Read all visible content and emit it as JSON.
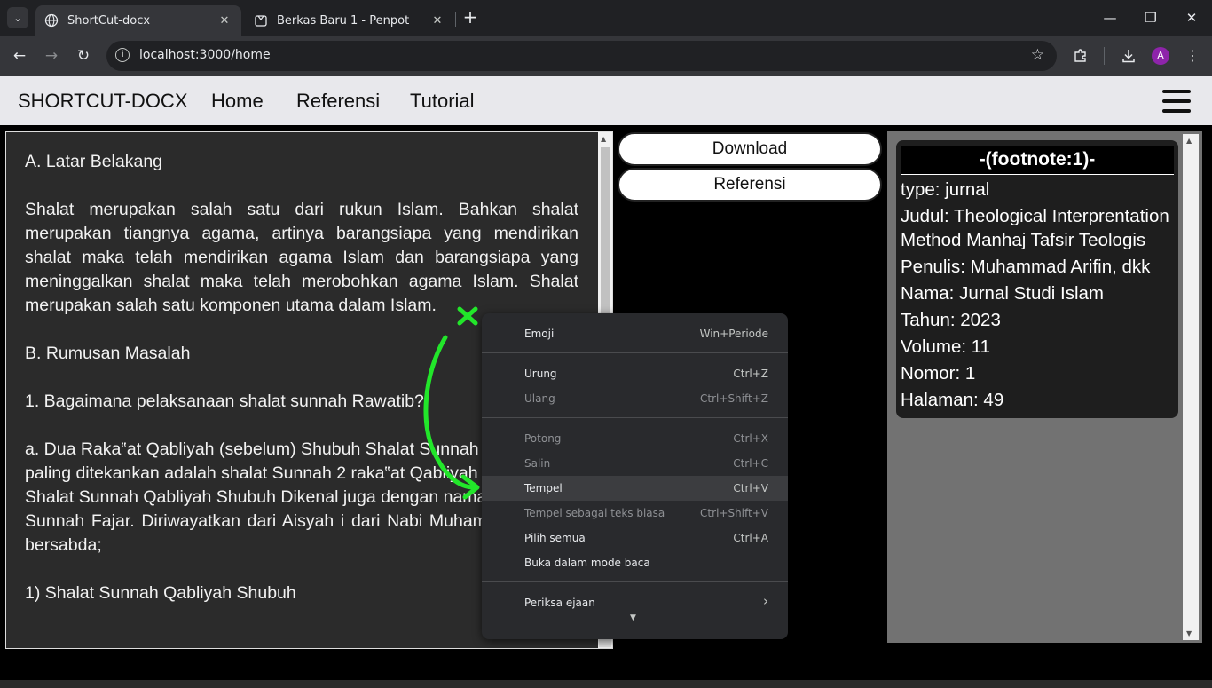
{
  "browser": {
    "tabs": [
      {
        "title": "ShortCut-docx",
        "active": true
      },
      {
        "title": "Berkas Baru 1 - Penpot",
        "active": false
      }
    ],
    "url": "localhost:3000/home",
    "profile_initial": "A"
  },
  "app": {
    "brand": "SHORTCUT-DOCX",
    "nav": [
      "Home",
      "Referensi",
      "Tutorial"
    ],
    "buttons": {
      "download": "Download",
      "referensi": "Referensi"
    }
  },
  "editor": {
    "text": "A. Latar Belakang\n\nShalat merupakan salah satu dari rukun Islam. Bahkan shalat merupakan tiangnya agama, artinya barangsiapa yang mendirikan shalat maka telah mendirikan agama Islam dan barangsiapa yang meninggalkan shalat maka telah merobohkan agama Islam. Shalat merupakan salah satu komponen utama dalam Islam.\n\nB. Rumusan Masalah\n\n1. Bagaimana pelaksanaan shalat sunnah Rawatib?\n\na. Dua Raka‟at Qabliyah (sebelum) Shubuh Shalat Sunnah yang\npaling ditekankan adalah shalat Sunnah 2 raka‟at Qabliyah Shubuh.\nShalat Sunnah Qabliyah Shubuh Dikenal juga dengan nama Shalat\nSunnah Fajar. Diriwayatkan dari Aisyah i dari Nabi Muhammad, beliau bersabda;\n\n1) Shalat Sunnah Qabliyah Shubuh"
  },
  "reference": {
    "title": "-(footnote:1)-",
    "lines": [
      "type: jurnal",
      "Judul: Theological Interprentation",
      "Method Manhaj Tafsir Teologis",
      "Penulis: Muhammad Arifin, dkk",
      "Nama: Jurnal Studi Islam",
      "Tahun: 2023",
      "Volume: 11",
      "Nomor: 1",
      "Halaman: 49"
    ]
  },
  "context_menu": {
    "items": [
      {
        "label": "Emoji",
        "shortcut": "Win+Periode",
        "disabled": false
      },
      {
        "label": "Urung",
        "shortcut": "Ctrl+Z",
        "disabled": false
      },
      {
        "label": "Ulang",
        "shortcut": "Ctrl+Shift+Z",
        "disabled": true
      },
      {
        "label": "Potong",
        "shortcut": "Ctrl+X",
        "disabled": true
      },
      {
        "label": "Salin",
        "shortcut": "Ctrl+C",
        "disabled": true
      },
      {
        "label": "Tempel",
        "shortcut": "Ctrl+V",
        "disabled": false,
        "hovered": true
      },
      {
        "label": "Tempel sebagai teks biasa",
        "shortcut": "Ctrl+Shift+V",
        "disabled": true
      },
      {
        "label": "Pilih semua",
        "shortcut": "Ctrl+A",
        "disabled": false
      },
      {
        "label": "Buka dalam mode baca",
        "shortcut": "",
        "disabled": false
      },
      {
        "label": "Periksa ejaan",
        "shortcut": "›",
        "disabled": false
      }
    ]
  },
  "colors": {
    "annotation": "#22e62a",
    "menu_bg": "#292a2d",
    "editor_bg": "#2b2b2b"
  },
  "icons": [
    "tab-search-icon",
    "globe-icon",
    "penpot-icon",
    "close-icon",
    "plus-icon",
    "minimize-icon",
    "restore-icon",
    "back-icon",
    "forward-icon",
    "reload-icon",
    "info-icon",
    "star-icon",
    "extensions-icon",
    "download-icon",
    "kebab-icon",
    "hamburger-icon"
  ]
}
